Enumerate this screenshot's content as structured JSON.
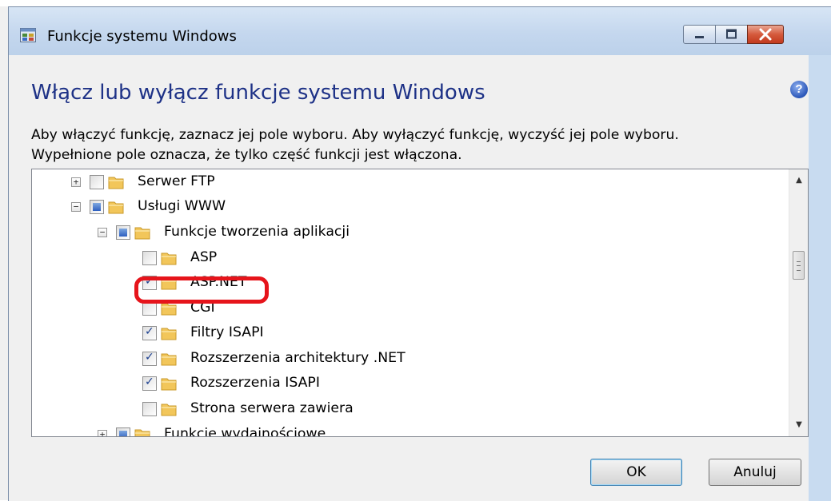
{
  "window": {
    "title": "Funkcje systemu Windows",
    "controls": [
      "minimize",
      "maximize",
      "close"
    ]
  },
  "heading": "Włącz lub wyłącz funkcje systemu Windows",
  "description": {
    "line1": "Aby włączyć funkcję, zaznacz jej pole wyboru. Aby wyłączyć funkcję, wyczyść jej pole wyboru.",
    "line2": "Wypełnione pole oznacza, że tylko część funkcji jest włączona."
  },
  "tree": {
    "items": [
      {
        "label": "Serwer FTP",
        "state": "unchecked",
        "expander": "+"
      },
      {
        "label": "Usługi WWW",
        "state": "partial",
        "expander": "−"
      },
      {
        "label": "Funkcje tworzenia aplikacji",
        "state": "partial",
        "expander": "−"
      },
      {
        "label": "ASP",
        "state": "unchecked"
      },
      {
        "label": "ASP.NET",
        "state": "checked",
        "highlighted": true
      },
      {
        "label": "CGI",
        "state": "unchecked"
      },
      {
        "label": "Filtry ISAPI",
        "state": "checked"
      },
      {
        "label": "Rozszerzenia architektury .NET",
        "state": "checked"
      },
      {
        "label": "Rozszerzenia ISAPI",
        "state": "checked"
      },
      {
        "label": "Strona serwera zawiera",
        "state": "unchecked"
      },
      {
        "label": "Funkcje wydajnościowe",
        "state": "partial",
        "expander": "+"
      }
    ]
  },
  "buttons": {
    "ok": "OK",
    "cancel": "Anuluj"
  },
  "colors": {
    "heading": "#1e3287",
    "highlight": "#e6141b",
    "titlebar": "#c4d7ee"
  }
}
